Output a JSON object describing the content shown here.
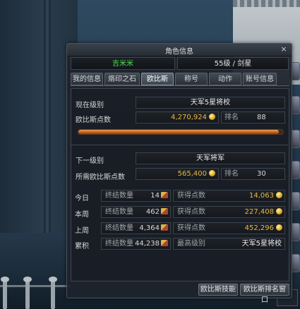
{
  "window": {
    "title": "角色信息",
    "close_glyph": "×"
  },
  "character": {
    "name": "吉米米",
    "level_class": "55级 / 剑星"
  },
  "tabs": [
    {
      "label": "我的信息",
      "active": false
    },
    {
      "label": "烙印之石",
      "active": false
    },
    {
      "label": "欧比斯",
      "active": true
    },
    {
      "label": "称号",
      "active": false
    },
    {
      "label": "动作",
      "active": false
    },
    {
      "label": "账号信息",
      "active": false
    }
  ],
  "current": {
    "rank_label": "现在级别",
    "rank_value": "天军5星将校",
    "points_label": "欧比斯点数",
    "points_value": "4,270,924",
    "ranking_label": "排名",
    "ranking_value": "88",
    "progress_fraction": 0.98
  },
  "next": {
    "rank_label": "下一级别",
    "rank_value": "天军将军",
    "required_label": "所需欧比斯点数",
    "required_value": "565,400",
    "ranking_label": "排名",
    "ranking_value": "30"
  },
  "stats": [
    {
      "period": "今日",
      "kill_label": "终结数量",
      "kill_value": "14",
      "gain_label": "获得点数",
      "gain_value": "14,063"
    },
    {
      "period": "本周",
      "kill_label": "终结数量",
      "kill_value": "462",
      "gain_label": "获得点数",
      "gain_value": "227,408"
    },
    {
      "period": "上周",
      "kill_label": "终结数量",
      "kill_value": "4,364",
      "gain_label": "获得点数",
      "gain_value": "452,296"
    }
  ],
  "cumulative": {
    "period": "累积",
    "kill_label": "终结数量",
    "kill_value": "44,238",
    "highest_label": "最高级别",
    "highest_value": "天军5星将校"
  },
  "buttons": {
    "skills": "欧比斯技能",
    "ranking_window": "欧比斯排名窗口"
  },
  "colors": {
    "name_green": "#4ee04e",
    "gold": "#e8b83c",
    "progress": "#d87030"
  }
}
